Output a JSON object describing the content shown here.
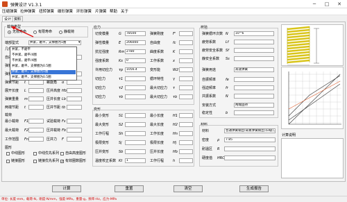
{
  "window": {
    "title": "弹簧设计 V1.3.1",
    "min": "─",
    "max": "□",
    "close": "✕"
  },
  "menu": [
    "压缩弹簧",
    "拉伸弹簧",
    "扭转弹簧",
    "碟形弹簧",
    "环形弹簧",
    "片弹簧",
    "帮助",
    "关于"
  ],
  "tabs": [
    "设计",
    "资料"
  ],
  "left": {
    "group_type": "载荷类型",
    "radios": [
      "无限寿命",
      "有限寿命",
      "静载荷"
    ],
    "end_label": "端部型式",
    "dropdown_value": "并紧，磨平，支撑圈为1圈",
    "dropdown_options": [
      "并紧，不磨平",
      "不并紧，磨平/4圈",
      "不并紧，磨平/4圈",
      "并紧，磨平，支撑圈为0.5圈",
      "并紧，磨平，支撑圈为1圈",
      "并紧，磨平，支撑圈为0.5圈"
    ],
    "geom_title": "几何",
    "rows": [
      {
        "a": "自由长度",
        "s": "H0",
        "b": "长度",
        "s2": "d"
      },
      {
        "a": "弹簧外径",
        "s": "D2",
        "b": "",
        "s2": ""
      },
      {
        "a": "弹簧内径",
        "s": "D1",
        "b": "中径",
        "s2": "D"
      },
      {
        "a": "弹簧节距",
        "s": "t",
        "b": "螺旋角",
        "s2": "α"
      },
      {
        "a": "展开长度",
        "s": "L",
        "b": "压并高度",
        "s2": "Hb"
      },
      {
        "a": "弹簧重量",
        "s": "m",
        "b": "压并长度",
        "s2": "Lb"
      },
      {
        "a": "两端节距",
        "s": "t",
        "b": "压并节距",
        "s2": "tb"
      }
    ],
    "load_title": "载荷",
    "load_rows": [
      {
        "a": "最小载荷",
        "s": "F1",
        "b": "试验载荷",
        "s2": "Fs"
      },
      {
        "a": "最大载荷",
        "s": "F2",
        "b": "压并载荷",
        "s2": "Fb"
      },
      {
        "a": "工作范围",
        "s": "Fn",
        "b": "压并力",
        "s2": "F"
      }
    ],
    "graph_title": "图形",
    "checks": [
      "中线图形",
      "中线优先系列",
      "自由高度图形",
      "链接图形",
      "链接优先系列",
      "有效圈数图形"
    ],
    "checks_on": [
      false,
      false,
      false,
      false,
      false,
      true
    ]
  },
  "mid": {
    "top_rows": [
      {
        "a": "切变模量",
        "s": "G",
        "v": "78500",
        "b": "弹簧刚度",
        "s2": "F'"
      },
      {
        "a": "弹性模量",
        "s": "E",
        "v": "206000",
        "b": "自由度",
        "s2": "fc"
      },
      {
        "a": "抗拉强度",
        "s": "Rm",
        "v": "2780",
        "b": "曲度系数",
        "s2": "K"
      },
      {
        "a": "强度系数",
        "s": "Ks",
        "v": "0",
        "b": "工作系数",
        "s2": "x"
      },
      {
        "a": "许用切应力",
        "s": "τp",
        "v": "1056.4",
        "b": "变形能",
        "s2": "W2"
      },
      {
        "a": "切应力",
        "s": "τ1",
        "v": "",
        "b": "循环特性",
        "s2": "γ"
      },
      {
        "a": "切应力",
        "s": "τ2",
        "v": "",
        "b": "最大切应力",
        "s2": "τ"
      },
      {
        "a": "切应力",
        "s": "τb",
        "v": "",
        "b": "最大切应力",
        "s2": "τb"
      }
    ],
    "stress_title": "应力",
    "def_title": "变形",
    "def_rows": [
      {
        "a": "最小变形",
        "s": "S1",
        "b": "最小长度",
        "s2": "H1"
      },
      {
        "a": "最大变形",
        "s": "S2",
        "b": "最大长度",
        "s2": "H2"
      },
      {
        "a": "工作行程",
        "s": "Sh",
        "b": "工作长度",
        "s2": "Hn"
      },
      {
        "a": "极限变形",
        "s": "Sj",
        "b": "极限长度",
        "s2": "Hj"
      },
      {
        "a": "压并变形",
        "s": "Sb",
        "b": "压并长度",
        "s2": "Hb"
      },
      {
        "a": "温度校正系数",
        "s": "Kt",
        "v": "1",
        "b": "工作行程",
        "s2": "h"
      }
    ]
  },
  "right": {
    "check_title": "校验",
    "check_rows": [
      {
        "a": "弹簧循环次数",
        "s": "N",
        "v": "10^6"
      },
      {
        "a": "疲劳系数",
        "s": "Lf",
        "v": ""
      },
      {
        "a": "疲劳安全系数",
        "s": "Sf",
        "v": ""
      },
      {
        "a": "静安全系数",
        "s": "Ss",
        "v": ""
      }
    ],
    "use_label": "弹簧用途",
    "use_value": "高速弹簧",
    "freq_rows": [
      {
        "a": "自振频率",
        "s": "fe"
      },
      {
        "a": "强迫频率",
        "s": "fr"
      },
      {
        "a": "共振系数",
        "s": "N"
      }
    ],
    "safe_label": "安装方式",
    "safe_value": "两端固持",
    "stab_label": "稳定性",
    "stab_s": "b",
    "mat_title": "材料",
    "mat_rows": [
      {
        "a": "材料",
        "v": "普通弹簧钢丝(碳素弹簧钢丝)(D级)，中级"
      },
      {
        "a": "密度",
        "s": "ρ",
        "v": "7.85"
      },
      {
        "a": "耐温区",
        "s": "R",
        "v": ""
      },
      {
        "a": "硬度值",
        "s": "HRC",
        "v": ""
      }
    ],
    "result_title": "计算说明"
  },
  "buttons": [
    "计算",
    "重置",
    "清空",
    "生成报告"
  ],
  "status": "单位: 长度-mm，载荷-N，刚度-N/mm，强度-MPa，重量-g，频率-Hz，应力-MPa"
}
